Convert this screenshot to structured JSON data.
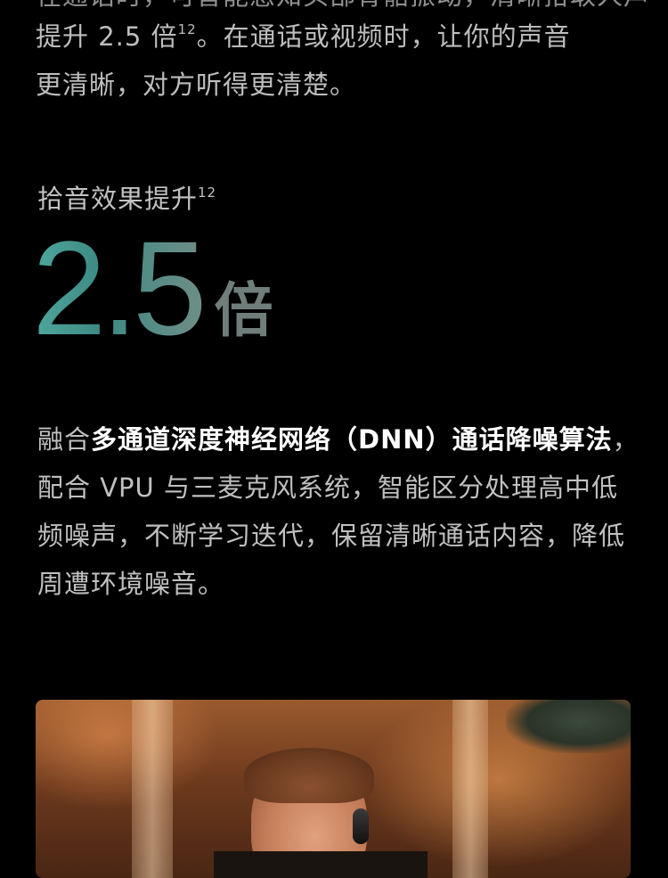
{
  "intro": {
    "partial_line": "在通话时，可智能感知头部骨骼振动，清晰拾取人声",
    "line1_prefix": "提升 2.5 倍",
    "line1_sup": "12",
    "line1_suffix": "。在通话或视频时，让你的声音",
    "line2": "更清晰，对方听得更清楚。"
  },
  "stat": {
    "label": "拾音效果提升",
    "label_sup": "12",
    "number": "2.5",
    "unit": "倍"
  },
  "description": {
    "p1": "融合",
    "p2_bold": "多通道深度神经网络（DNN）通话降噪算法",
    "p3": "，配合 VPU 与三麦克风系统，智能区分处理高中低频噪声，不断学习迭代，保留清晰通话内容，降低周遭环境噪音。"
  },
  "colors": {
    "background": "#000000",
    "accent_gradient_start": "#4fa79e",
    "accent_gradient_end": "#6e8d87",
    "body_text": "#c0c0c0",
    "emphasis_text": "#ffffff"
  }
}
